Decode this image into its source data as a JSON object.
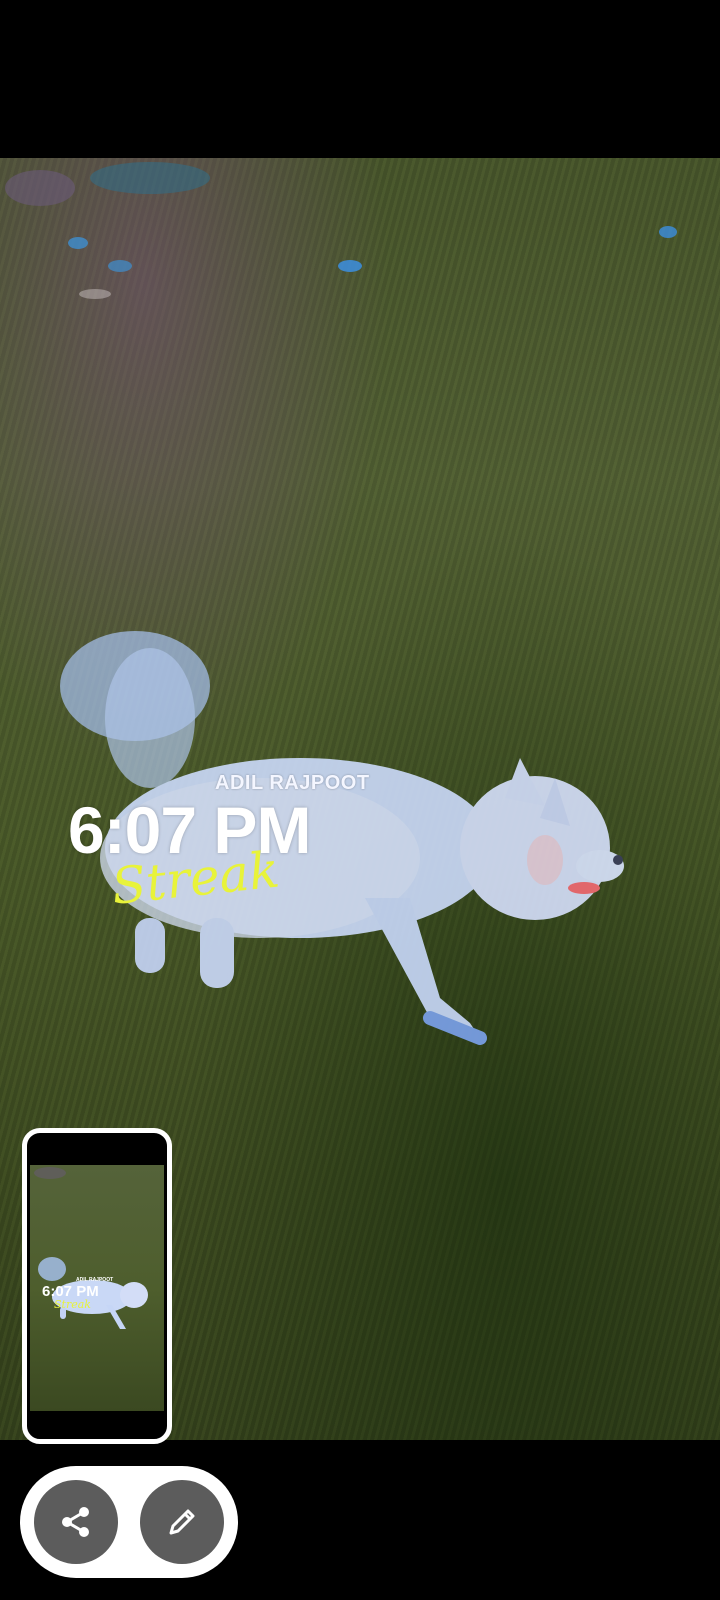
{
  "photo": {
    "overlay": {
      "name": "ADIL RAJPOOT",
      "time": "6:07 PM",
      "label": "Streak"
    }
  },
  "thumbnail": {
    "overlay": {
      "name": "ADIL RAJPOOT",
      "time": "6:07 PM",
      "label": "Streak"
    }
  },
  "actions": {
    "share_icon": "share-icon",
    "edit_icon": "pencil-icon"
  },
  "colors": {
    "streak_accent": "#e8f33a",
    "button_bg": "#5c5c5c",
    "pill_bg": "#ffffff"
  }
}
